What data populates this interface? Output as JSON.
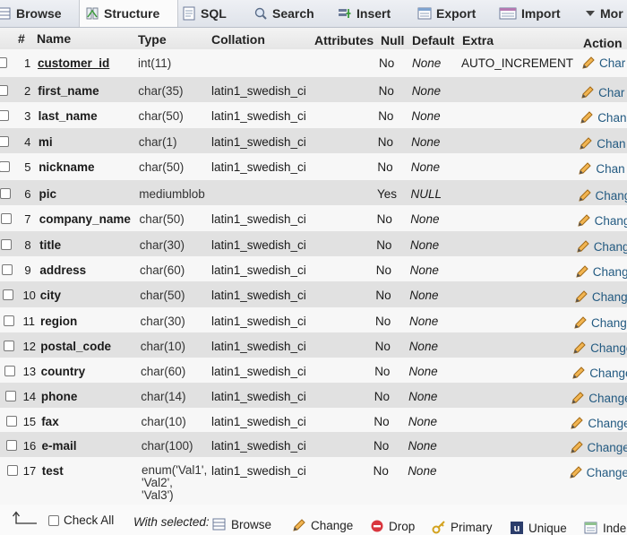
{
  "tabs": [
    {
      "label": "Browse",
      "icon": "browse-icon"
    },
    {
      "label": "Structure",
      "icon": "structure-icon"
    },
    {
      "label": "SQL",
      "icon": "sql-icon"
    },
    {
      "label": "Search",
      "icon": "search-icon"
    },
    {
      "label": "Insert",
      "icon": "insert-icon"
    },
    {
      "label": "Export",
      "icon": "export-icon"
    },
    {
      "label": "Import",
      "icon": "import-icon"
    },
    {
      "label": "Mor",
      "icon": "caret-down-icon"
    }
  ],
  "columns": {
    "hash": "#",
    "name": "Name",
    "type": "Type",
    "collation": "Collation",
    "attributes": "Attributes",
    "null": "Null",
    "default": "Default",
    "extra": "Extra",
    "action": "Action"
  },
  "rows": [
    {
      "num": "1",
      "name": "customer_id",
      "type": "int(11)",
      "collation": "",
      "null": "No",
      "default": "None",
      "extra": "AUTO_INCREMENT",
      "action": "Char"
    },
    {
      "num": "2",
      "name": "first_name",
      "type": "char(35)",
      "collation": "latin1_swedish_ci",
      "null": "No",
      "default": "None",
      "extra": "",
      "action": "Char"
    },
    {
      "num": "3",
      "name": "last_name",
      "type": "char(50)",
      "collation": "latin1_swedish_ci",
      "null": "No",
      "default": "None",
      "extra": "",
      "action": "Chan"
    },
    {
      "num": "4",
      "name": "mi",
      "type": "char(1)",
      "collation": "latin1_swedish_ci",
      "null": "No",
      "default": "None",
      "extra": "",
      "action": "Chan"
    },
    {
      "num": "5",
      "name": "nickname",
      "type": "char(50)",
      "collation": "latin1_swedish_ci",
      "null": "No",
      "default": "None",
      "extra": "",
      "action": "Chan"
    },
    {
      "num": "6",
      "name": "pic",
      "type": "mediumblob",
      "collation": "",
      "null": "Yes",
      "default": "NULL",
      "extra": "",
      "action": "Chang"
    },
    {
      "num": "7",
      "name": "company_name",
      "type": "char(50)",
      "collation": "latin1_swedish_ci",
      "null": "No",
      "default": "None",
      "extra": "",
      "action": "Chang"
    },
    {
      "num": "8",
      "name": "title",
      "type": "char(30)",
      "collation": "latin1_swedish_ci",
      "null": "No",
      "default": "None",
      "extra": "",
      "action": "Chang"
    },
    {
      "num": "9",
      "name": "address",
      "type": "char(60)",
      "collation": "latin1_swedish_ci",
      "null": "No",
      "default": "None",
      "extra": "",
      "action": "Chang"
    },
    {
      "num": "10",
      "name": "city",
      "type": "char(50)",
      "collation": "latin1_swedish_ci",
      "null": "No",
      "default": "None",
      "extra": "",
      "action": "Change"
    },
    {
      "num": "11",
      "name": "region",
      "type": "char(30)",
      "collation": "latin1_swedish_ci",
      "null": "No",
      "default": "None",
      "extra": "",
      "action": "Change"
    },
    {
      "num": "12",
      "name": "postal_code",
      "type": "char(10)",
      "collation": "latin1_swedish_ci",
      "null": "No",
      "default": "None",
      "extra": "",
      "action": "Change"
    },
    {
      "num": "13",
      "name": "country",
      "type": "char(60)",
      "collation": "latin1_swedish_ci",
      "null": "No",
      "default": "None",
      "extra": "",
      "action": "Change"
    },
    {
      "num": "14",
      "name": "phone",
      "type": "char(14)",
      "collation": "latin1_swedish_ci",
      "null": "No",
      "default": "None",
      "extra": "",
      "action": "Change"
    },
    {
      "num": "15",
      "name": "fax",
      "type": "char(10)",
      "collation": "latin1_swedish_ci",
      "null": "No",
      "default": "None",
      "extra": "",
      "action": "Change"
    },
    {
      "num": "16",
      "name": "e-mail",
      "type": "char(100)",
      "collation": "latin1_swedish_ci",
      "null": "No",
      "default": "None",
      "extra": "",
      "action": "Change"
    },
    {
      "num": "17",
      "name": "test",
      "type": "enum('Val1',\n'Val2',\n'Val3')",
      "collation": "latin1_swedish_ci",
      "null": "No",
      "default": "None",
      "extra": "",
      "action": "Change"
    }
  ],
  "footer": {
    "check_all": "Check All",
    "with_selected": "With selected:",
    "actions": [
      {
        "label": "Browse",
        "icon": "browse-icon"
      },
      {
        "label": "Change",
        "icon": "pencil-icon"
      },
      {
        "label": "Drop",
        "icon": "drop-icon"
      },
      {
        "label": "Primary",
        "icon": "key-icon"
      },
      {
        "label": "Unique",
        "icon": "unique-icon"
      },
      {
        "label": "Inde",
        "icon": "index-icon"
      }
    ]
  },
  "colors": {
    "link": "#235a81",
    "pencil": "#e8a33c",
    "drop": "#d9363e",
    "tab_bg": "#e4e8ee",
    "row_odd": "#f7f7f7",
    "row_even": "#e1e1e1"
  }
}
